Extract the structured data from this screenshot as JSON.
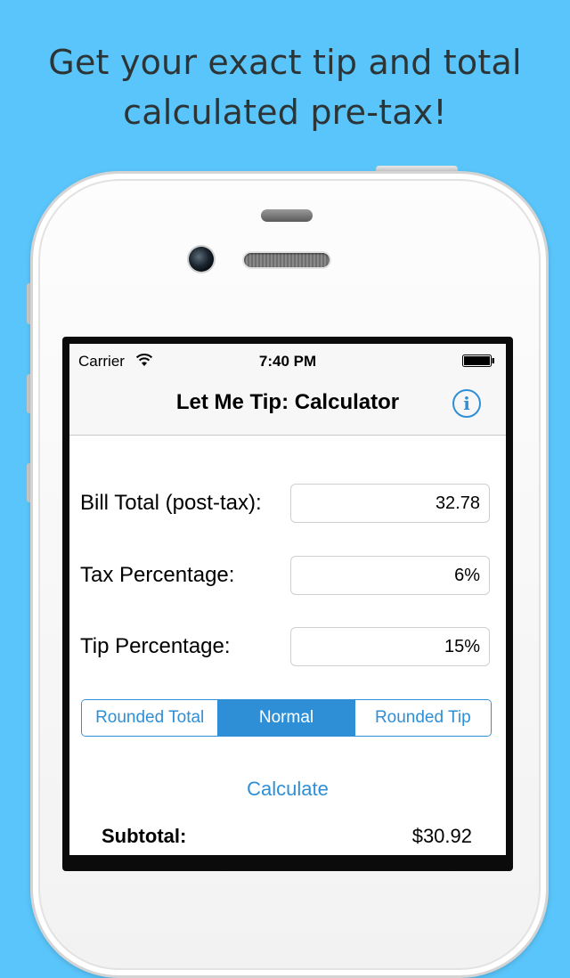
{
  "headline": {
    "line1": "Get your exact tip and total",
    "line2": "calculated pre-tax!"
  },
  "status_bar": {
    "carrier": "Carrier",
    "time": "7:40 PM",
    "icons": [
      "wifi-icon",
      "battery-icon"
    ]
  },
  "nav": {
    "title": "Let Me Tip: Calculator",
    "info_icon": "info-icon",
    "info_glyph": "i"
  },
  "form": {
    "bill_total": {
      "label": "Bill Total (post-tax):",
      "value": "32.78"
    },
    "tax_percentage": {
      "label": "Tax Percentage:",
      "value": "6%"
    },
    "tip_percentage": {
      "label": "Tip Percentage:",
      "value": "15%"
    }
  },
  "mode": {
    "options": [
      "Rounded Total",
      "Normal",
      "Rounded Tip"
    ],
    "selected": "Normal"
  },
  "calculate_label": "Calculate",
  "results": {
    "subtotal": {
      "label": "Subtotal:",
      "value": "$30.92"
    }
  },
  "colors": {
    "background": "#5ac5fa",
    "accent": "#2f8fd6",
    "headline_text": "#2d3436"
  }
}
